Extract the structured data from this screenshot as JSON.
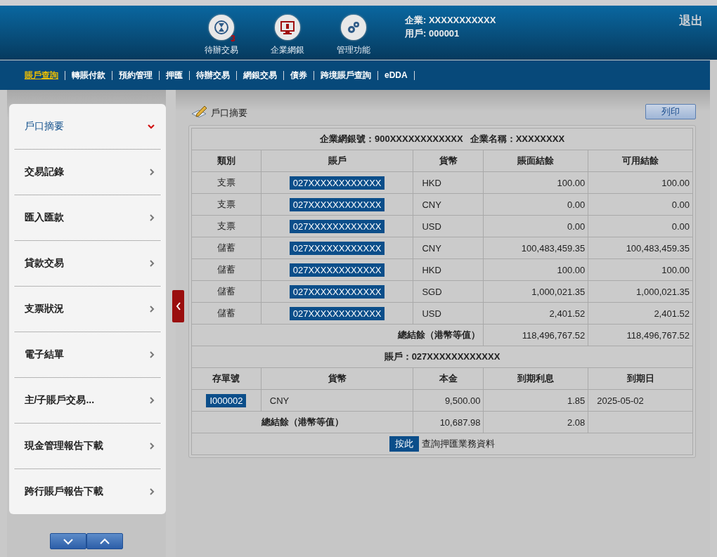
{
  "header": {
    "shortcuts": [
      {
        "kind": "pending",
        "label": "待辦交易",
        "badge": "3"
      },
      {
        "kind": "ebank",
        "label": "企業網銀"
      },
      {
        "kind": "admin",
        "label": "管理功能"
      }
    ],
    "company": "企業: XXXXXXXXXXX",
    "user": "用戶: 000001",
    "logout": "退出"
  },
  "nav": [
    {
      "label": "賬戶查詢",
      "selected": true
    },
    {
      "label": "轉賬付款",
      "selected": false
    },
    {
      "label": "預約管理",
      "selected": false
    },
    {
      "label": "押匯",
      "selected": false
    },
    {
      "label": "待辦交易",
      "selected": false
    },
    {
      "label": "網銀交易",
      "selected": false
    },
    {
      "label": "債券",
      "selected": false
    },
    {
      "label": "跨境賬戶查詢",
      "selected": false
    },
    {
      "label": "eDDA",
      "selected": false
    }
  ],
  "sidebar": {
    "items": [
      {
        "label": "戶口摘要",
        "selected": true
      },
      {
        "label": "交易記錄",
        "selected": false
      },
      {
        "label": "匯入匯款",
        "selected": false
      },
      {
        "label": "貸款交易",
        "selected": false
      },
      {
        "label": "支票狀況",
        "selected": false
      },
      {
        "label": "電子結單",
        "selected": false
      },
      {
        "label": "主/子賬戶交易...",
        "selected": false
      },
      {
        "label": "現金管理報告下載",
        "selected": false
      },
      {
        "label": "跨行賬戶報告下載",
        "selected": false
      }
    ]
  },
  "page_title": "戶口摘要",
  "print_button": "列印",
  "summary": {
    "bank_no": "企業網銀號：900XXXXXXXXXXXX",
    "company_name": "企業名稱：XXXXXXXX",
    "columns": [
      "類別",
      "賬戶",
      "貨幣",
      "賬面結餘",
      "可用結餘"
    ],
    "rows": [
      [
        "支票",
        "027XXXXXXXXXXXX",
        "HKD",
        "100.00",
        "100.00"
      ],
      [
        "支票",
        "027XXXXXXXXXXXX",
        "CNY",
        "0.00",
        "0.00"
      ],
      [
        "支票",
        "027XXXXXXXXXXXX",
        "USD",
        "0.00",
        "0.00"
      ],
      [
        "儲蓄",
        "027XXXXXXXXXXXX",
        "CNY",
        "100,483,459.35",
        "100,483,459.35"
      ],
      [
        "儲蓄",
        "027XXXXXXXXXXXX",
        "HKD",
        "100.00",
        "100.00"
      ],
      [
        "儲蓄",
        "027XXXXXXXXXXXX",
        "SGD",
        "1,000,021.35",
        "1,000,021.35"
      ],
      [
        "儲蓄",
        "027XXXXXXXXXXXX",
        "USD",
        "2,401.52",
        "2,401.52"
      ]
    ],
    "total_label": "總結餘（港幣等值）",
    "totals": [
      "118,496,767.52",
      "118,496,767.52"
    ]
  },
  "deposits": {
    "account": "賬戶：027XXXXXXXXXXXX",
    "columns": [
      "存單號",
      "貨幣",
      "本金",
      "到期利息",
      "到期日"
    ],
    "rows": [
      [
        "I000002",
        "CNY",
        "9,500.00",
        "1.85",
        "2025-05-02"
      ]
    ],
    "total_label": "總結餘（港幣等值）",
    "totals": [
      "10,687.98",
      "2.08"
    ]
  },
  "footer": {
    "button": "按此",
    "text": "查詢押匯業務資料"
  }
}
